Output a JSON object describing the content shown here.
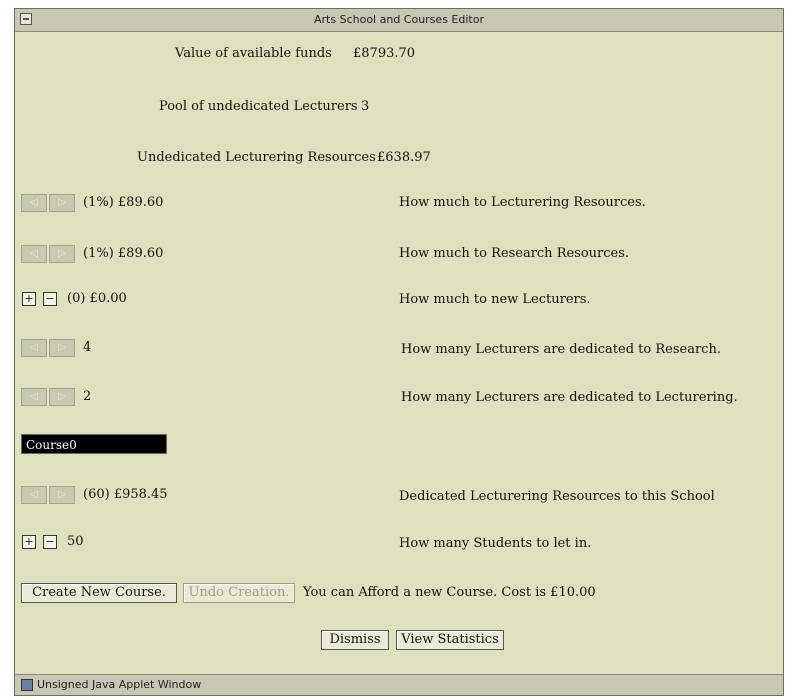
{
  "window": {
    "title": "Arts School and Courses Editor"
  },
  "funds": {
    "label": "Value of available funds",
    "value": "£8793.70"
  },
  "pool": {
    "label": "Pool of undedicated Lecturers",
    "value": "3"
  },
  "undedicated": {
    "label": "Undedicated Lecturering Resources",
    "value": "£638.97"
  },
  "rows": {
    "lect_res": {
      "value": "(1%) £89.60",
      "desc": "How much to Lecturering Resources."
    },
    "research_res": {
      "value": "(1%) £89.60",
      "desc": "How much to Research Resources."
    },
    "new_lect": {
      "value": "(0) £0.00",
      "desc": "How much to new Lecturers."
    },
    "lect_research": {
      "value": "4",
      "desc": "How many Lecturers are dedicated to Research."
    },
    "lect_lect": {
      "value": "2",
      "desc": "How many Lecturers are dedicated to Lecturering."
    },
    "dedicated": {
      "value": "(60) £958.45",
      "desc": "Dedicated Lecturering Resources to this School"
    },
    "students": {
      "value": "50",
      "desc": "How many Students to let in."
    }
  },
  "course": {
    "name": "Course0"
  },
  "buttons": {
    "create": "Create New Course.",
    "undo": "Undo Creation.",
    "afford": "You can Afford a new Course. Cost is £10.00",
    "dismiss": "Dismiss",
    "stats": "View Statistics"
  },
  "icons": {
    "left": "◁",
    "right": "▷",
    "plus": "+",
    "minus": "−"
  },
  "status": {
    "text": "Unsigned Java Applet Window"
  },
  "colors": {
    "background": "#dfe0bd",
    "chrome": "#c9c7b3",
    "field": "#000000"
  }
}
